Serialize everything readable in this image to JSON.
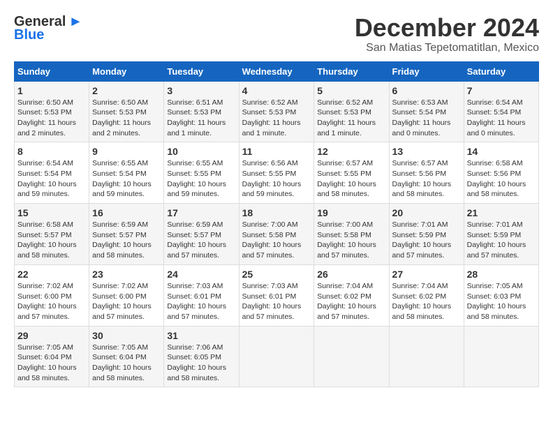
{
  "header": {
    "logo_line1": "General",
    "logo_line2": "Blue",
    "month": "December 2024",
    "location": "San Matias Tepetomatitlan, Mexico"
  },
  "weekdays": [
    "Sunday",
    "Monday",
    "Tuesday",
    "Wednesday",
    "Thursday",
    "Friday",
    "Saturday"
  ],
  "weeks": [
    [
      {
        "day": "1",
        "rise": "6:50 AM",
        "set": "5:53 PM",
        "daylight": "11 hours and 2 minutes."
      },
      {
        "day": "2",
        "rise": "6:50 AM",
        "set": "5:53 PM",
        "daylight": "11 hours and 2 minutes."
      },
      {
        "day": "3",
        "rise": "6:51 AM",
        "set": "5:53 PM",
        "daylight": "11 hours and 1 minute."
      },
      {
        "day": "4",
        "rise": "6:52 AM",
        "set": "5:53 PM",
        "daylight": "11 hours and 1 minute."
      },
      {
        "day": "5",
        "rise": "6:52 AM",
        "set": "5:53 PM",
        "daylight": "11 hours and 1 minute."
      },
      {
        "day": "6",
        "rise": "6:53 AM",
        "set": "5:54 PM",
        "daylight": "11 hours and 0 minutes."
      },
      {
        "day": "7",
        "rise": "6:54 AM",
        "set": "5:54 PM",
        "daylight": "11 hours and 0 minutes."
      }
    ],
    [
      {
        "day": "8",
        "rise": "6:54 AM",
        "set": "5:54 PM",
        "daylight": "10 hours and 59 minutes."
      },
      {
        "day": "9",
        "rise": "6:55 AM",
        "set": "5:54 PM",
        "daylight": "10 hours and 59 minutes."
      },
      {
        "day": "10",
        "rise": "6:55 AM",
        "set": "5:55 PM",
        "daylight": "10 hours and 59 minutes."
      },
      {
        "day": "11",
        "rise": "6:56 AM",
        "set": "5:55 PM",
        "daylight": "10 hours and 59 minutes."
      },
      {
        "day": "12",
        "rise": "6:57 AM",
        "set": "5:55 PM",
        "daylight": "10 hours and 58 minutes."
      },
      {
        "day": "13",
        "rise": "6:57 AM",
        "set": "5:56 PM",
        "daylight": "10 hours and 58 minutes."
      },
      {
        "day": "14",
        "rise": "6:58 AM",
        "set": "5:56 PM",
        "daylight": "10 hours and 58 minutes."
      }
    ],
    [
      {
        "day": "15",
        "rise": "6:58 AM",
        "set": "5:57 PM",
        "daylight": "10 hours and 58 minutes."
      },
      {
        "day": "16",
        "rise": "6:59 AM",
        "set": "5:57 PM",
        "daylight": "10 hours and 58 minutes."
      },
      {
        "day": "17",
        "rise": "6:59 AM",
        "set": "5:57 PM",
        "daylight": "10 hours and 57 minutes."
      },
      {
        "day": "18",
        "rise": "7:00 AM",
        "set": "5:58 PM",
        "daylight": "10 hours and 57 minutes."
      },
      {
        "day": "19",
        "rise": "7:00 AM",
        "set": "5:58 PM",
        "daylight": "10 hours and 57 minutes."
      },
      {
        "day": "20",
        "rise": "7:01 AM",
        "set": "5:59 PM",
        "daylight": "10 hours and 57 minutes."
      },
      {
        "day": "21",
        "rise": "7:01 AM",
        "set": "5:59 PM",
        "daylight": "10 hours and 57 minutes."
      }
    ],
    [
      {
        "day": "22",
        "rise": "7:02 AM",
        "set": "6:00 PM",
        "daylight": "10 hours and 57 minutes."
      },
      {
        "day": "23",
        "rise": "7:02 AM",
        "set": "6:00 PM",
        "daylight": "10 hours and 57 minutes."
      },
      {
        "day": "24",
        "rise": "7:03 AM",
        "set": "6:01 PM",
        "daylight": "10 hours and 57 minutes."
      },
      {
        "day": "25",
        "rise": "7:03 AM",
        "set": "6:01 PM",
        "daylight": "10 hours and 57 minutes."
      },
      {
        "day": "26",
        "rise": "7:04 AM",
        "set": "6:02 PM",
        "daylight": "10 hours and 57 minutes."
      },
      {
        "day": "27",
        "rise": "7:04 AM",
        "set": "6:02 PM",
        "daylight": "10 hours and 58 minutes."
      },
      {
        "day": "28",
        "rise": "7:05 AM",
        "set": "6:03 PM",
        "daylight": "10 hours and 58 minutes."
      }
    ],
    [
      {
        "day": "29",
        "rise": "7:05 AM",
        "set": "6:04 PM",
        "daylight": "10 hours and 58 minutes."
      },
      {
        "day": "30",
        "rise": "7:05 AM",
        "set": "6:04 PM",
        "daylight": "10 hours and 58 minutes."
      },
      {
        "day": "31",
        "rise": "7:06 AM",
        "set": "6:05 PM",
        "daylight": "10 hours and 58 minutes."
      },
      null,
      null,
      null,
      null
    ]
  ],
  "labels": {
    "sunrise": "Sunrise:",
    "sunset": "Sunset:",
    "daylight": "Daylight:"
  }
}
